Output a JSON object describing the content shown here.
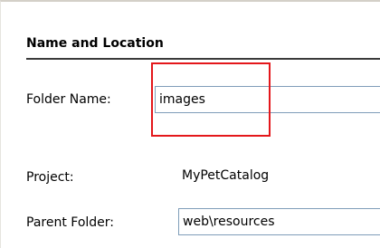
{
  "section": {
    "title": "Name and Location"
  },
  "fields": {
    "folder_name": {
      "label": "Folder Name:",
      "value": "images"
    },
    "project": {
      "label": "Project:",
      "value": "MyPetCatalog"
    },
    "parent_folder": {
      "label": "Parent Folder:",
      "value": "web\\resources"
    }
  },
  "colors": {
    "highlight": "#e4171b",
    "field_border": "#7f9db9",
    "rule": "#3a3a3a"
  }
}
